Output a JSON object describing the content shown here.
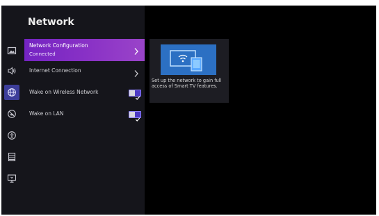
{
  "page_title": "Network",
  "sidebar_icons": [
    "picture-icon",
    "sound-icon",
    "network-globe-icon",
    "broadcast-icon",
    "accessibility-icon",
    "system-icon",
    "support-icon"
  ],
  "active_icon": "network-globe-icon",
  "menu": {
    "network_configuration": {
      "label": "Network Configuration",
      "status": "Connected"
    },
    "internet_connection": {
      "label": "Internet Connection"
    },
    "wake_on_wireless": {
      "label": "Wake on Wireless Network",
      "enabled": true
    },
    "wake_on_lan": {
      "label": "Wake on LAN",
      "enabled": true
    }
  },
  "info": {
    "text": "Set up the network to gain full access of Smart TV features."
  },
  "colors": {
    "background": "#000000",
    "panel": "#15151b",
    "selected_start": "#7424c2",
    "selected_end": "#9a44c9",
    "toggle_on": "#4d3bc4",
    "preview": "#2c70c3"
  }
}
